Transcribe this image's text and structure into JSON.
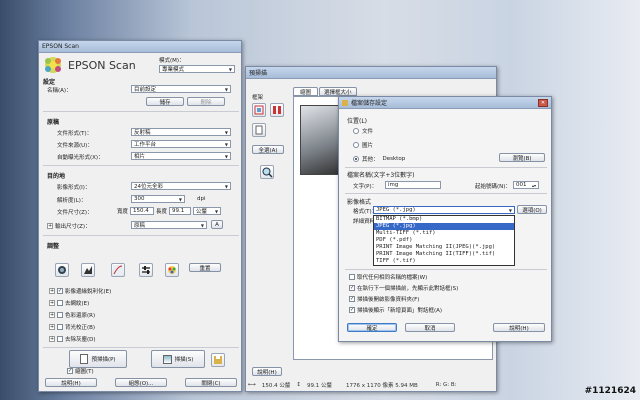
{
  "epson": {
    "title": "EPSON Scan",
    "logo": "EPSON Scan",
    "mode_label": "模式(M)：",
    "mode_value": "專業模式",
    "settings_header": "設定",
    "name_label": "名稱(A)：",
    "name_value": "目前設定",
    "save_btn": "儲存",
    "delete_btn": "刪除",
    "original_header": "原稿",
    "doc_type_label": "文件形式(T)：",
    "doc_type_value": "反射稿",
    "doc_source_label": "文件來源(U)：",
    "doc_source_value": "工作平台",
    "auto_exposure_label": "自動曝光形式(X)：",
    "auto_exposure_value": "相片",
    "dest_header": "目的地",
    "image_type_label": "影像形式(I)：",
    "image_type_value": "24位元全彩",
    "resolution_label": "解析度(L)：",
    "resolution_value": "300",
    "resolution_unit": "dpi",
    "doc_size_label": "文件尺寸(Z)：",
    "width_label": "寬度",
    "width_value": "150.4",
    "height_label": "長度",
    "height_value": "99.1",
    "size_unit": "公釐",
    "output_size_label": "輸出尺寸(Z)：",
    "output_size_value": "原稿",
    "adjust_header": "調整",
    "reset_btn": "重置",
    "adjust_items": [
      "影像邊緣銳利化(E)",
      "去網紋(E)",
      "色彩還原(R)",
      "背光校正(B)",
      "去除灰塵(D)"
    ],
    "adjust_checked": [
      true,
      false,
      false,
      false,
      false
    ],
    "preview_btn": "預掃描(P)",
    "scan_btn": "掃描(S)",
    "thumbnail_label": "縮圖(T)",
    "help_btn": "說明(H)",
    "config_btn": "組態(O)...",
    "close_btn": "關閉(C)"
  },
  "preview": {
    "title": "預掃描",
    "frame_label": "框架",
    "all_btn": "全選(A)",
    "tab_normal": "縮圖",
    "tab_marquee": "選擇框大小",
    "help_btn": "說明(H)",
    "status_width": "150.4 公釐",
    "status_height": "99.1 公釐",
    "status_pixels": "1776 x 1170 像素 5.94 MB",
    "status_rgb": "R: G: B:"
  },
  "save": {
    "title": "檔案儲存設定",
    "location_header": "位置(L)",
    "loc_docs": "文件",
    "loc_pictures": "圖片",
    "loc_other": "其他：",
    "loc_other_value": "Desktop",
    "browse_btn": "瀏覽(B)",
    "filename_header": "檔案名稱(文字+3位數字)",
    "prefix_label": "文字(P)：",
    "prefix_value": "img",
    "start_label": "起始號碼(N)：",
    "start_value": "001",
    "format_header": "影像格式",
    "type_label": "格式(T)：",
    "type_value": "JPEG (*.jpg)",
    "options_btn": "選項(O)",
    "details_label": "詳細資料：",
    "format_options": [
      "BITMAP (*.bmp)",
      "JPEG (*.jpg)",
      "Multi-TIFF (*.tif)",
      "PDF (*.pdf)",
      "PRINT Image Matching II(JPEG)(*.jpg)",
      "PRINT Image Matching II(TIFF)(*.tif)",
      "TIFF (*.tif)"
    ],
    "selected_option": 1,
    "checks": [
      "取代任何相同名稱的檔案(W)",
      "在執行下一個掃描前，先顯示此對話框(S)",
      "掃描後開啟影像資料夾(F)",
      "掃描後顯示「新增頁面」對話框(A)"
    ],
    "checks_state": [
      false,
      true,
      true,
      true
    ],
    "ok_btn": "確定",
    "cancel_btn": "取消",
    "help_btn": "說明(H)"
  },
  "watermark": "#1121624"
}
